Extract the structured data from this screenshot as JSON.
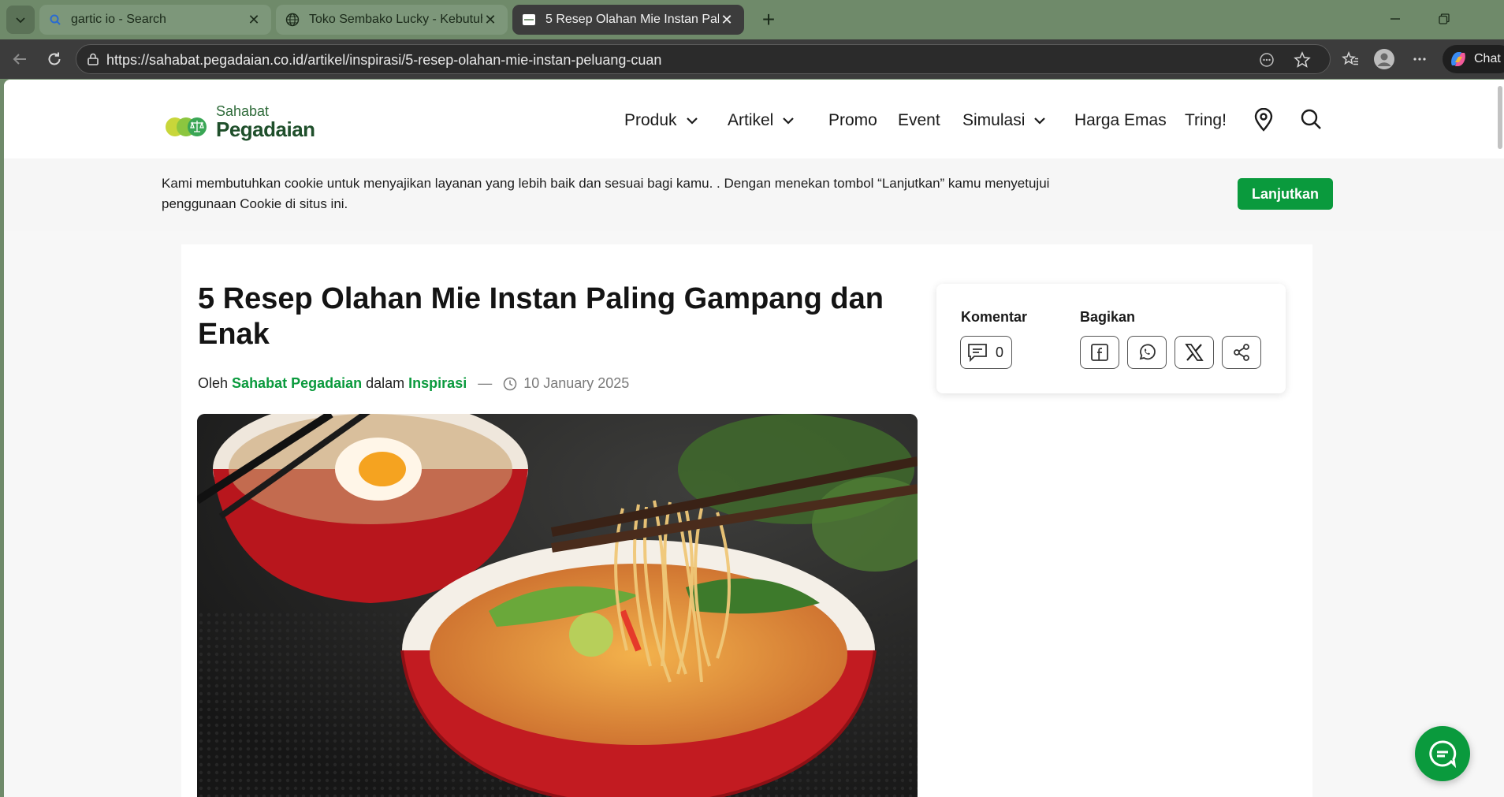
{
  "browser": {
    "tabs": [
      {
        "title": "gartic io - Search",
        "close": "✕"
      },
      {
        "title": "Toko Sembako Lucky - Kebutuhan",
        "close": "✕"
      },
      {
        "title": "5 Resep Olahan Mie Instan Paling G",
        "close": "✕"
      }
    ],
    "new_tab": "+",
    "address_url": "https://sahabat.pegadaian.co.id/artikel/inspirasi/5-resep-olahan-mie-instan-peluang-cuan",
    "chat_label": "Chat",
    "theme_color": "#6f8a6a"
  },
  "site": {
    "logo_top": "Sahabat",
    "logo_bottom": "Pegadaian",
    "brand_color": "#0a9a3d",
    "nav": {
      "produk": "Produk",
      "artikel": "Artikel",
      "promo": "Promo",
      "event": "Event",
      "simulasi": "Simulasi",
      "harga_emas": "Harga Emas",
      "tring": "Tring!"
    }
  },
  "cookie": {
    "text": "Kami membutuhkan cookie untuk menyajikan layanan yang lebih baik dan sesuai bagi kamu. . Dengan menekan tombol “Lanjutkan” kamu menyetujui penggunaan Cookie di situs ini.",
    "button": "Lanjutkan"
  },
  "article": {
    "title": "5 Resep Olahan Mie Instan Paling Gampang dan Enak",
    "by_prefix": "Oleh",
    "author": "Sahabat Pegadaian",
    "in_word": "dalam",
    "category": "Inspirasi",
    "separator": "—",
    "date": "10 January 2025"
  },
  "share": {
    "comments_label": "Komentar",
    "comment_count": "0",
    "share_label": "Bagikan"
  }
}
